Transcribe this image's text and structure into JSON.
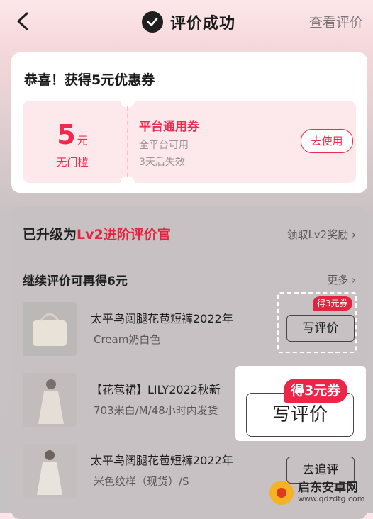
{
  "header": {
    "title": "评价成功",
    "view_reviews": "查看评价"
  },
  "coupon": {
    "heading": "恭喜！获得5元优惠券",
    "amount": "5",
    "unit": "元",
    "threshold": "无门槛",
    "name": "平台通用券",
    "scope": "全平台可用",
    "expiry": "3天后失效",
    "use_button": "去使用"
  },
  "level": {
    "prefix": "已升级为",
    "level_name": "Lv2进阶评价官",
    "reward_link": "领取Lv2奖励"
  },
  "continue": {
    "title": "继续评价可再得6元",
    "more": "更多"
  },
  "items": [
    {
      "title": "太平鸟阔腿花苞短裤2022年",
      "sub": "Cream奶白色",
      "action": "写评价",
      "badge": "得3元券"
    },
    {
      "title": "【花苞裙】LILY2022秋新",
      "sub": "703米白/M/48小时内发货",
      "action": "",
      "badge": ""
    },
    {
      "title": "太平鸟阔腿花苞短裤2022年",
      "sub": "米色纹样（现货）/S",
      "action": "去追评",
      "badge": ""
    }
  ],
  "highlight": {
    "badge": "得3元券",
    "button": "写评价"
  },
  "watermark": {
    "name": "启东安卓网",
    "url": "www.qdzdtg.com"
  },
  "colors": {
    "accent": "#ee2b4d",
    "coupon_bg": "#fde8ec"
  }
}
